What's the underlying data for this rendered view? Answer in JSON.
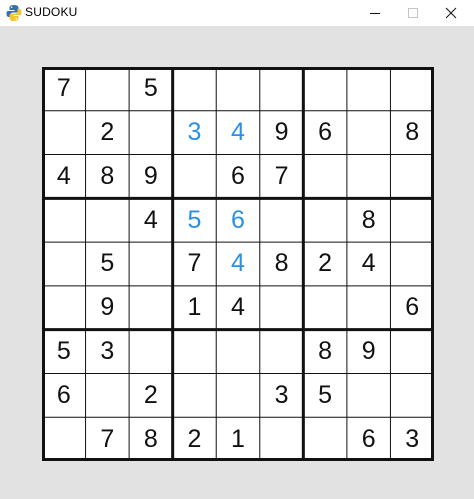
{
  "window": {
    "title": "SUDOKU",
    "icon": "python-logo-icon",
    "controls": [
      "minimize-icon",
      "maximize-icon",
      "close-icon"
    ]
  },
  "colors": {
    "background": "#e2e2e2",
    "given_digit": "#111111",
    "user_digit": "#2a90e6",
    "grid": "#111111"
  },
  "board": {
    "rows": [
      [
        "7",
        "",
        "5",
        "",
        "",
        "",
        "",
        "",
        ""
      ],
      [
        "",
        "2",
        "",
        "3",
        "4",
        "9",
        "6",
        "",
        "8"
      ],
      [
        "4",
        "8",
        "9",
        "",
        "6",
        "7",
        "",
        "",
        ""
      ],
      [
        "",
        "",
        "4",
        "5",
        "6",
        "",
        "",
        "8",
        ""
      ],
      [
        "",
        "5",
        "",
        "7",
        "4",
        "8",
        "2",
        "4",
        ""
      ],
      [
        "",
        "9",
        "",
        "1",
        "4",
        "",
        "",
        "",
        "6"
      ],
      [
        "5",
        "3",
        "",
        "",
        "",
        "",
        "8",
        "9",
        ""
      ],
      [
        "6",
        "",
        "2",
        "",
        "",
        "3",
        "5",
        "",
        ""
      ],
      [
        "",
        "7",
        "8",
        "2",
        "1",
        "",
        "",
        "6",
        "3"
      ]
    ],
    "user_entered": [
      [
        1,
        3
      ],
      [
        1,
        4
      ],
      [
        3,
        3
      ],
      [
        3,
        4
      ],
      [
        4,
        4
      ]
    ]
  }
}
